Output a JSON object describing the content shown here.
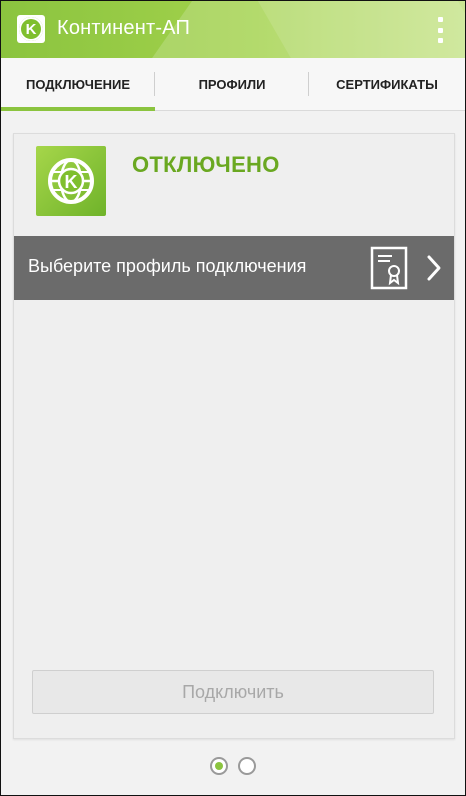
{
  "app": {
    "title": "Континент-АП",
    "logo_letter": "K",
    "brand_color": "#8bc43f"
  },
  "tabs": [
    {
      "label": "ПОДКЛЮЧЕНИЕ",
      "active": true
    },
    {
      "label": "ПРОФИЛИ",
      "active": false
    },
    {
      "label": "СЕРТИФИКАТЫ",
      "active": false
    }
  ],
  "connection": {
    "status": "ОТКЛЮЧЕНО",
    "status_color": "#6aa821",
    "profile_prompt": "Выберите профиль подключения",
    "connect_button": "Подключить"
  },
  "pager": {
    "pages": 2,
    "active_index": 0
  },
  "icons": {
    "app_logo": "k-logo-icon",
    "menu": "overflow-menu-icon",
    "certificate": "certificate-icon",
    "chevron": "chevron-right-icon"
  }
}
